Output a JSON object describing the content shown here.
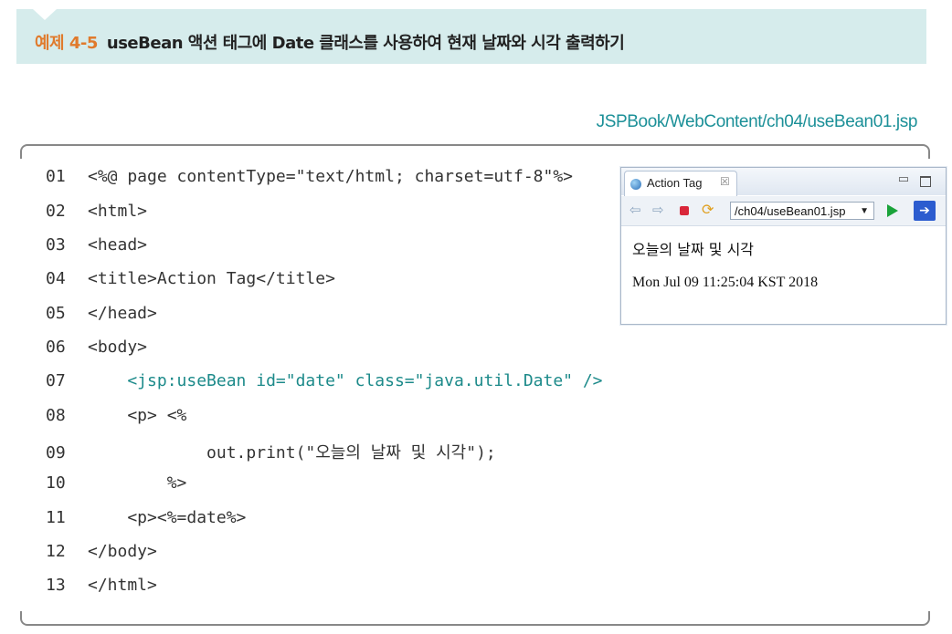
{
  "banner": {
    "number": "예제 4-5",
    "title": "useBean 액션 태그에 Date 클래스를 사용하여 현재 날짜와 시각 출력하기"
  },
  "file_path": "JSPBook/WebContent/ch04/useBean01.jsp",
  "code_lines": [
    {
      "num": "01",
      "text": "<%@ page contentType=\"text/html; charset=utf-8\"%>"
    },
    {
      "num": "02",
      "text": "<html>"
    },
    {
      "num": "03",
      "text": "<head>"
    },
    {
      "num": "04",
      "text": "<title>Action Tag</title>"
    },
    {
      "num": "05",
      "text": "</head>"
    },
    {
      "num": "06",
      "text": "<body>"
    },
    {
      "num": "07",
      "text": "    <jsp:useBean id=\"date\" class=\"java.util.Date\" />"
    },
    {
      "num": "08",
      "text": "    <p> <%"
    },
    {
      "num": "09",
      "text": "            out.print(\"오늘의 날짜 및 시각\");"
    },
    {
      "num": "10",
      "text": "        %>"
    },
    {
      "num": "11",
      "text": "    <p><%=date%>"
    },
    {
      "num": "12",
      "text": "</body>"
    },
    {
      "num": "13",
      "text": "</html>"
    }
  ],
  "browser": {
    "tab_label": "Action Tag",
    "close_glyph": "☒",
    "url": "/ch04/useBean01.jsp",
    "content_line1": "오늘의 날짜 및 시각",
    "content_line2": "Mon Jul 09 11:25:04 KST 2018"
  }
}
